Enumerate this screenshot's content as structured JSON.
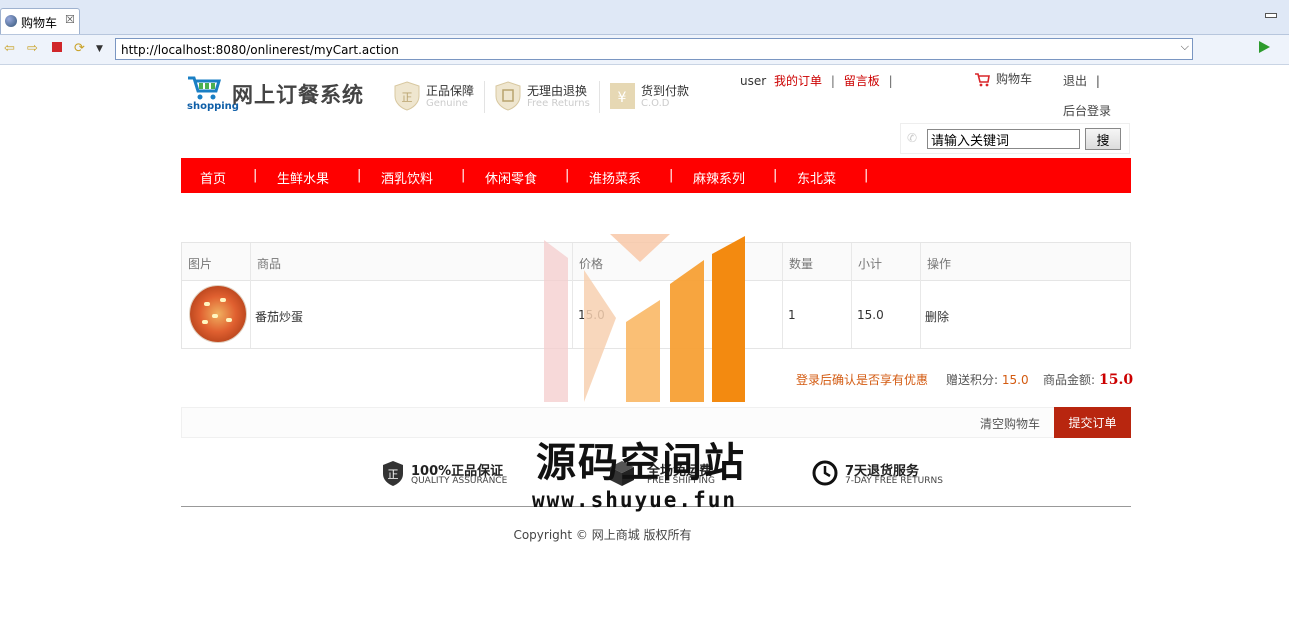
{
  "browser": {
    "tab_title": "购物车",
    "tab_close": "☒",
    "url": "http://localhost:8080/onlinerest/myCart.action"
  },
  "header": {
    "logo_word": "shopping",
    "site_title": "网上订餐系统",
    "badges": [
      {
        "title": "正品保障",
        "subtitle": "Genuine",
        "icon": "shield-genuine-icon"
      },
      {
        "title": "无理由退换",
        "subtitle": "Free Returns",
        "icon": "shield-return-icon"
      },
      {
        "title": "货到付款",
        "subtitle": "C.O.D",
        "icon": "cod-icon"
      }
    ],
    "user": "user",
    "my_orders": "我的订单",
    "guestbook": "留言板",
    "sep": "|",
    "cart": "购物车",
    "logout": "退出",
    "admin_login": "后台登录",
    "search_value": "请输入关键词",
    "search_button": "搜"
  },
  "nav": {
    "items": [
      "首页",
      "生鲜水果",
      "酒乳饮料",
      "休闲零食",
      "淮扬菜系",
      "麻辣系列",
      "东北菜"
    ],
    "sep": "|"
  },
  "cart": {
    "headers": [
      "图片",
      "商品",
      "价格",
      "数量",
      "小计",
      "操作"
    ],
    "rows": [
      {
        "image": "dish-image",
        "name": "番茄炒蛋",
        "price": "15.0",
        "qty": "1",
        "subtotal": "15.0",
        "action": "删除"
      }
    ],
    "promo": "登录后确认是否享有优惠",
    "points_label": "赠送积分:",
    "points_value": "15.0",
    "amount_label": "商品金额:",
    "amount_value": "15.0",
    "clear_label": "清空购物车",
    "submit_label": "提交订单"
  },
  "guarantees": [
    {
      "title": "100%正品保证",
      "subtitle": "QUALITY ASSURANCE",
      "icon": "quality-shield-icon"
    },
    {
      "title": "全场免运费",
      "subtitle": "FREE SHIPPING",
      "icon": "box-icon"
    },
    {
      "title": "7天退货服务",
      "subtitle": "7-DAY FREE RETURNS",
      "icon": "clock-icon"
    }
  ],
  "footer": {
    "copyright": "Copyright © 网上商城 版权所有"
  },
  "watermark": {
    "title": "源码空间站",
    "url": "www.shuyue.fun"
  },
  "colors": {
    "nav_bg": "#ff0000",
    "submit_bg": "#b8260f",
    "accent_text": "#d35a10"
  }
}
